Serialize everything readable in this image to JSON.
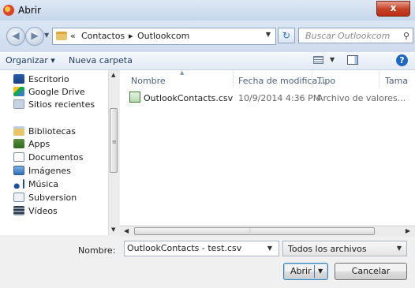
{
  "window": {
    "title": "Abrir",
    "close_label": "x"
  },
  "address": {
    "root_chevron": "«",
    "crumbs": [
      "Contactos",
      "Outlookcom"
    ],
    "separator": "▸"
  },
  "search": {
    "placeholder": "Buscar Outlookcom"
  },
  "toolbar": {
    "organize": "Organizar ▾",
    "new_folder": "Nueva carpeta"
  },
  "navpane": {
    "items": [
      {
        "label": "Escritorio",
        "icon": "desktop-icon"
      },
      {
        "label": "Google Drive",
        "icon": "google-drive-icon"
      },
      {
        "label": "Sitios recientes",
        "icon": "recent-places-icon"
      },
      {
        "label": "Bibliotecas",
        "icon": "libraries-icon"
      },
      {
        "label": "Apps",
        "icon": "apps-icon"
      },
      {
        "label": "Documentos",
        "icon": "documents-icon"
      },
      {
        "label": "Imágenes",
        "icon": "images-icon"
      },
      {
        "label": "Música",
        "icon": "music-icon"
      },
      {
        "label": "Subversion",
        "icon": "subversion-icon"
      },
      {
        "label": "Vídeos",
        "icon": "videos-icon"
      }
    ]
  },
  "filelist": {
    "columns": [
      "Nombre",
      "Fecha de modifica...",
      "Tipo",
      "Tama"
    ],
    "rows": [
      {
        "name": "OutlookContacts.csv",
        "date": "10/9/2014 4:36 PM",
        "type": "Archivo de valores..."
      }
    ]
  },
  "bottom": {
    "name_label": "Nombre:",
    "name_value": "OutlookContacts - test.csv",
    "filetype": "Todos los archivos",
    "open_label": "Abrir",
    "cancel_label": "Cancelar"
  }
}
